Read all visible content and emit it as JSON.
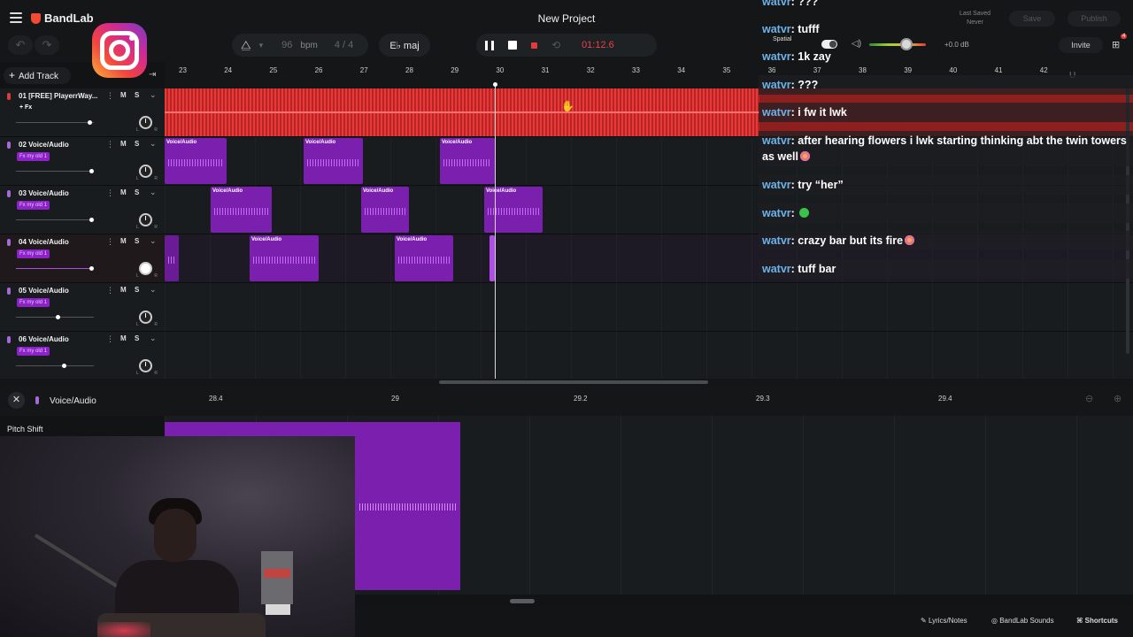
{
  "app": {
    "brand": "BandLab",
    "project_title": "New Project"
  },
  "toolbar": {
    "bpm_value": "96",
    "bpm_unit": "bpm",
    "time_signature": "4 / 4",
    "key": "E♭ maj",
    "time": "01:12.6"
  },
  "save": {
    "last_saved_label": "Last Saved",
    "last_saved_value": "Never",
    "save_label": "Save",
    "publish_label": "Publish"
  },
  "mixer": {
    "spatial_label": "Spatial",
    "volume_db": "+0.0 dB",
    "invite_label": "Invite",
    "volume_level": 0.55
  },
  "add_track_label": "Add Track",
  "ruler": [
    "23",
    "24",
    "25",
    "26",
    "27",
    "28",
    "29",
    "30",
    "31",
    "32",
    "33",
    "34",
    "35",
    "36",
    "37",
    "38",
    "39",
    "40",
    "41",
    "42"
  ],
  "tracks": [
    {
      "name": "01  [FREE] PlayerrWay...",
      "fx": "+ Fx",
      "fx_plain": true,
      "volume": 0.95,
      "mic_color": "#e23b3b"
    },
    {
      "name": "02  Voice/Audio",
      "fx": "Fx my old 1",
      "volume": 0.98,
      "mic_color": "#a56ad8"
    },
    {
      "name": "03  Voice/Audio",
      "fx": "Fx my old 1",
      "volume": 0.98,
      "mic_color": "#a56ad8"
    },
    {
      "name": "04  Voice/Audio",
      "fx": "Fx my old 1",
      "volume": 0.98,
      "mic_color": "#a56ad8"
    },
    {
      "name": "05  Voice/Audio",
      "fx": "Fx my old 1",
      "volume": 0.55,
      "mic_color": "#a56ad8"
    },
    {
      "name": "06  Voice/Audio",
      "fx": "Fx my old 1",
      "volume": 0.63,
      "mic_color": "#a56ad8"
    }
  ],
  "track_buttons": {
    "mute": "M",
    "solo": "S",
    "pan_left": "L",
    "pan_right": "R"
  },
  "clip_label": "Voice/Audio",
  "chat": [
    {
      "user": "watvr",
      "text": "???"
    },
    {
      "user": "watvr",
      "text": "tufff"
    },
    {
      "user": "watvr",
      "text": "1k zay"
    },
    {
      "user": "watvr",
      "text": "???"
    },
    {
      "user": "watvr",
      "text": "i fw it lwk"
    },
    {
      "user": "watvr",
      "text": "after hearing flowers i lwk starting thinking abt the twin towers as well"
    },
    {
      "user": "watvr",
      "text": "try “her”"
    },
    {
      "user": "watvr",
      "text": ""
    },
    {
      "user": "watvr",
      "text": "crazy bar but its fire"
    },
    {
      "user": "watvr",
      "text": "tuff bar"
    }
  ],
  "editor": {
    "title": "Voice/Audio",
    "param_label": "Pitch Shift",
    "ruler": [
      "28.4",
      "29",
      "29.2",
      "29.3",
      "29.4"
    ]
  },
  "bottom_bar": {
    "lyrics": "Lyrics/Notes",
    "sounds": "BandLab Sounds",
    "shortcuts": "Shortcuts"
  },
  "colors": {
    "accent_red": "#e7414a",
    "clip_purple": "#7b1fae",
    "chat_username": "#6db3e8"
  }
}
